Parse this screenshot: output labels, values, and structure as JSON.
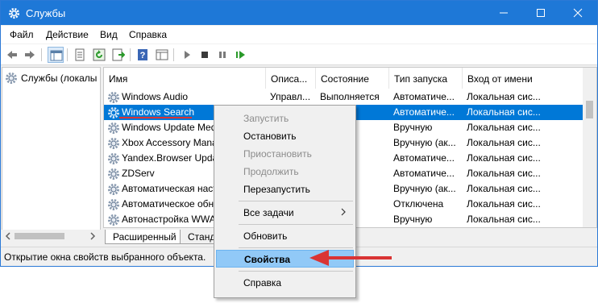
{
  "window": {
    "title": "Службы",
    "icon": "gear-icon"
  },
  "menubar": {
    "items": [
      "Файл",
      "Действие",
      "Вид",
      "Справка"
    ]
  },
  "toolbar": {
    "icons": [
      "back-arrow-icon",
      "forward-arrow-icon",
      "show-tree-icon",
      "properties-sheet-icon",
      "refresh-icon",
      "export-list-icon",
      "help-icon",
      "mmc-pane-icon",
      "play-icon",
      "stop-icon",
      "pause-icon",
      "restart-icon"
    ]
  },
  "tree": {
    "root_label": "Службы (локалы"
  },
  "table": {
    "columns": [
      "Имя",
      "Описа...",
      "Состояние",
      "Тип запуска",
      "Вход от имени"
    ],
    "rows": [
      {
        "name": "Windows Audio",
        "desc": "Управл...",
        "state": "Выполняется",
        "startup": "Автоматиче...",
        "logon": "Локальная сис..."
      },
      {
        "name": "Windows Search",
        "desc": "",
        "state": "яется",
        "startup": "Автоматиче...",
        "logon": "Локальная сис...",
        "selected": true
      },
      {
        "name": "Windows Update Med",
        "desc": "",
        "state": "",
        "startup": "Вручную",
        "logon": "Локальная сис..."
      },
      {
        "name": "Xbox Accessory Mana",
        "desc": "",
        "state": "",
        "startup": "Вручную (ак...",
        "logon": "Локальная сис..."
      },
      {
        "name": "Yandex.Browser Upda",
        "desc": "",
        "state": "яется",
        "startup": "Автоматиче...",
        "logon": "Локальная сис..."
      },
      {
        "name": "ZDServ",
        "desc": "",
        "state": "яется",
        "startup": "Автоматиче...",
        "logon": "Локальная сис..."
      },
      {
        "name": "Автоматическая наст",
        "desc": "",
        "state": "яется",
        "startup": "Вручную (ак...",
        "logon": "Локальная сис..."
      },
      {
        "name": "Автоматическое обн",
        "desc": "",
        "state": "",
        "startup": "Отключена",
        "logon": "Локальная сис..."
      },
      {
        "name": "Автонастройка WWA",
        "desc": "",
        "state": "",
        "startup": "Вручную",
        "logon": "Локальная сис..."
      }
    ]
  },
  "tabs": [
    "Расширенный",
    "Станд"
  ],
  "status": {
    "text": "Открытие окна свойств выбранного объекта."
  },
  "context_menu": {
    "items": [
      {
        "label": "Запустить",
        "enabled": false
      },
      {
        "label": "Остановить",
        "enabled": true
      },
      {
        "label": "Приостановить",
        "enabled": false
      },
      {
        "label": "Продолжить",
        "enabled": false
      },
      {
        "label": "Перезапустить",
        "enabled": true
      },
      {
        "label": "Все задачи",
        "enabled": true,
        "submenu": true
      },
      {
        "label": "Обновить",
        "enabled": true
      },
      {
        "label": "Свойства",
        "enabled": true,
        "highlighted": true
      },
      {
        "label": "Справка",
        "enabled": true
      }
    ]
  },
  "colors": {
    "titlebar": "#1e78d7",
    "selection": "#0078d7",
    "highlight": "#91c9f7",
    "annotation": "#d93434"
  }
}
